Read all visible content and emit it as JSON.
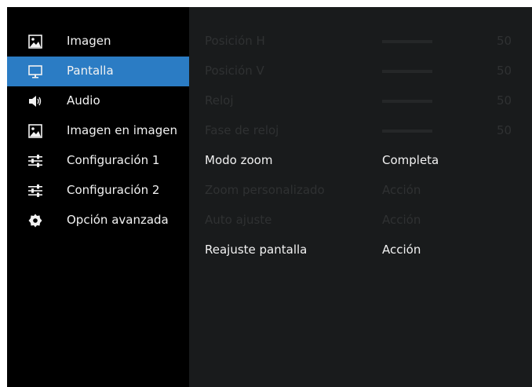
{
  "sidebar": {
    "items": [
      {
        "label": "Imagen",
        "icon": "picture-icon",
        "selected": false
      },
      {
        "label": "Pantalla",
        "icon": "monitor-icon",
        "selected": true
      },
      {
        "label": "Audio",
        "icon": "speaker-icon",
        "selected": false
      },
      {
        "label": "Imagen en imagen",
        "icon": "pip-icon",
        "selected": false
      },
      {
        "label": "Configuración 1",
        "icon": "sliders-icon",
        "selected": false
      },
      {
        "label": "Configuración 2",
        "icon": "sliders-icon",
        "selected": false
      },
      {
        "label": "Opción avanzada",
        "icon": "gear-icon",
        "selected": false
      }
    ]
  },
  "panel": {
    "rows": [
      {
        "label": "Posición H",
        "type": "slider",
        "value": "50",
        "enabled": false
      },
      {
        "label": "Posición V",
        "type": "slider",
        "value": "50",
        "enabled": false
      },
      {
        "label": "Reloj",
        "type": "slider",
        "value": "50",
        "enabled": false
      },
      {
        "label": "Fase de reloj",
        "type": "slider",
        "value": "50",
        "enabled": false
      },
      {
        "label": "Modo zoom",
        "type": "text",
        "value": "Completa",
        "enabled": true
      },
      {
        "label": "Zoom personalizado",
        "type": "text",
        "value": "Acción",
        "enabled": false
      },
      {
        "label": "Auto ajuste",
        "type": "text",
        "value": "Acción",
        "enabled": false
      },
      {
        "label": "Reajuste pantalla",
        "type": "text",
        "value": "Acción",
        "enabled": true
      }
    ]
  },
  "colors": {
    "selected_bg": "#2b7cc4",
    "sidebar_bg": "#000000",
    "panel_bg": "#191b1c",
    "text": "#f2f2f2",
    "disabled_text": "#2f3132"
  }
}
